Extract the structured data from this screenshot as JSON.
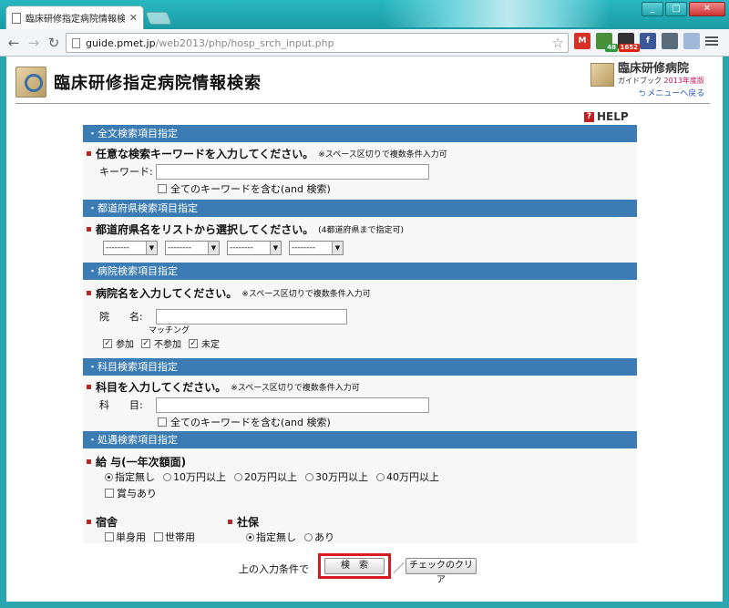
{
  "browser": {
    "tab_title": "臨床研修指定病院情報検",
    "url_host": "guide.pmet.jp",
    "url_path": "/web2013/php/hosp_srch_input.php",
    "ext_badges": [
      "48",
      "1652"
    ],
    "win_buttons": [
      "_",
      "□",
      "✕"
    ]
  },
  "header": {
    "title": "臨床研修指定病院情報検索",
    "guide_title": "臨床研修病院",
    "guide_sub": "ガイドブック",
    "guide_year": "2013年度版",
    "back_link": "メニューへ戻る",
    "help": "HELP"
  },
  "sections": {
    "fulltext": {
      "head": "・全文検索項目指定",
      "question": "任意な検索キーワードを入力してください。",
      "note": "※スペース区切りで複数条件入力可",
      "label": "キーワード:",
      "value": "",
      "all_words": "全てのキーワードを含む(and 検索)"
    },
    "pref": {
      "head": "・都道府県検索項目指定",
      "question": "都道府県名をリストから選択してください。",
      "note": "(4都道府県まで指定可)",
      "selects": [
        "--------",
        "--------",
        "--------",
        "--------"
      ]
    },
    "hospital": {
      "head": "・病院検索項目指定",
      "question": "病院名を入力してください。",
      "note": "※スペース区切りで複数条件入力可",
      "label": "院　　名:",
      "value": "",
      "matching_label": "マッチング",
      "matching": [
        "参加",
        "不参加",
        "未定"
      ]
    },
    "subject": {
      "head": "・科目検索項目指定",
      "question": "科目を入力してください。",
      "note": "※スペース区切りで複数条件入力可",
      "label": "科　　目:",
      "value": "",
      "all_words": "全てのキーワードを含む(and 検索)"
    },
    "benefits": {
      "head": "・処遇検索項目指定",
      "salary_q": "給 与(一年次額面)",
      "salary_opts": [
        "指定無し",
        "10万円以上",
        "20万円以上",
        "30万円以上",
        "40万円以上"
      ],
      "bonus": "賞与あり",
      "dorm_q": "宿舎",
      "dorm_opts": [
        "単身用",
        "世帯用"
      ],
      "social_q": "社保",
      "social_opts": [
        "指定無し",
        "あり"
      ]
    }
  },
  "footer": {
    "text": "上の入力条件で",
    "search": "検　索",
    "slash": "／",
    "clear": "チェックのクリア"
  }
}
